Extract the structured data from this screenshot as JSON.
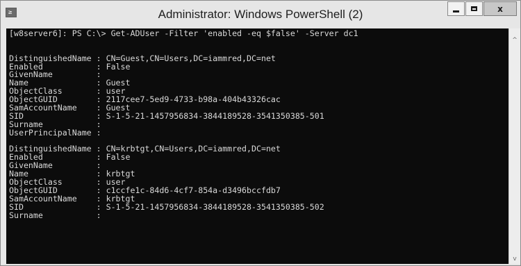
{
  "window": {
    "title": "Administrator: Windows PowerShell (2)",
    "icon_glyph": "≥",
    "controls": {
      "minimize": "minimize-icon",
      "maximize": "maximize-icon",
      "close": "close-icon",
      "close_glyph": "x"
    },
    "accent_color": "#0c0c0c"
  },
  "console": {
    "lines": [
      "[w8server6]: PS C:\\> Get-ADUser -Filter 'enabled -eq $false' -Server dc1",
      "",
      "",
      "DistinguishedName : CN=Guest,CN=Users,DC=iammred,DC=net",
      "Enabled           : False",
      "GivenName         :",
      "Name              : Guest",
      "ObjectClass       : user",
      "ObjectGUID        : 2117cee7-5ed9-4733-b98a-404b43326cac",
      "SamAccountName    : Guest",
      "SID               : S-1-5-21-1457956834-3844189528-3541350385-501",
      "Surname           :",
      "UserPrincipalName :",
      "",
      "DistinguishedName : CN=krbtgt,CN=Users,DC=iammred,DC=net",
      "Enabled           : False",
      "GivenName         :",
      "Name              : krbtgt",
      "ObjectClass       : user",
      "ObjectGUID        : c1ccfe1c-84d6-4cf7-854a-d3496bccfdb7",
      "SamAccountName    : krbtgt",
      "SID               : S-1-5-21-1457956834-3844189528-3541350385-502",
      "Surname           :"
    ]
  },
  "scrollbar": {
    "up_glyph": "^",
    "down_glyph": "v"
  }
}
